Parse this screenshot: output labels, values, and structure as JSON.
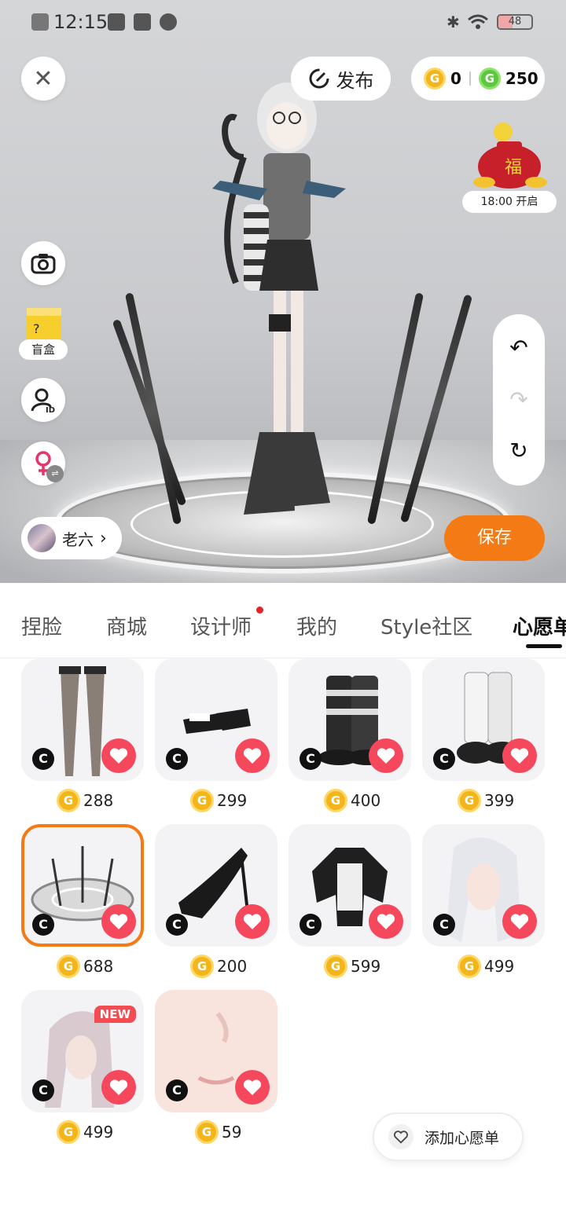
{
  "status_bar": {
    "time": "12:15",
    "battery": "48"
  },
  "top_controls": {
    "publish_label": "发布",
    "coins": {
      "gold": "0",
      "green": "250"
    },
    "lucky_bag": {
      "time_label": "18:00 开启"
    },
    "blind_box_label": "盲盒",
    "user_name": "老六",
    "save_label": "保存"
  },
  "tabs": [
    {
      "label": "捏脸"
    },
    {
      "label": "商城"
    },
    {
      "label": "设计师",
      "has_dot": true
    },
    {
      "label": "我的"
    },
    {
      "label": "Style社区"
    },
    {
      "label": "心愿单",
      "active": true
    }
  ],
  "items": [
    {
      "name": "stockings",
      "price": "288"
    },
    {
      "name": "black-white-shoes",
      "price": "299"
    },
    {
      "name": "striped-boots",
      "price": "400"
    },
    {
      "name": "white-boots",
      "price": "399"
    },
    {
      "name": "sword-circle-effect",
      "price": "688",
      "selected": true
    },
    {
      "name": "black-heels",
      "price": "200"
    },
    {
      "name": "black-jacket",
      "price": "599"
    },
    {
      "name": "silver-hair",
      "price": "499"
    },
    {
      "name": "pink-hair",
      "price": "499",
      "new_label": "NEW"
    },
    {
      "name": "face-makeup",
      "price": "59"
    }
  ],
  "add_wishlist_label": "添加心愿单",
  "colors": {
    "accent": "#f47a16",
    "heart": "#f6485c",
    "gold_coin": "#f2b51b",
    "green_coin": "#5cc83f"
  }
}
